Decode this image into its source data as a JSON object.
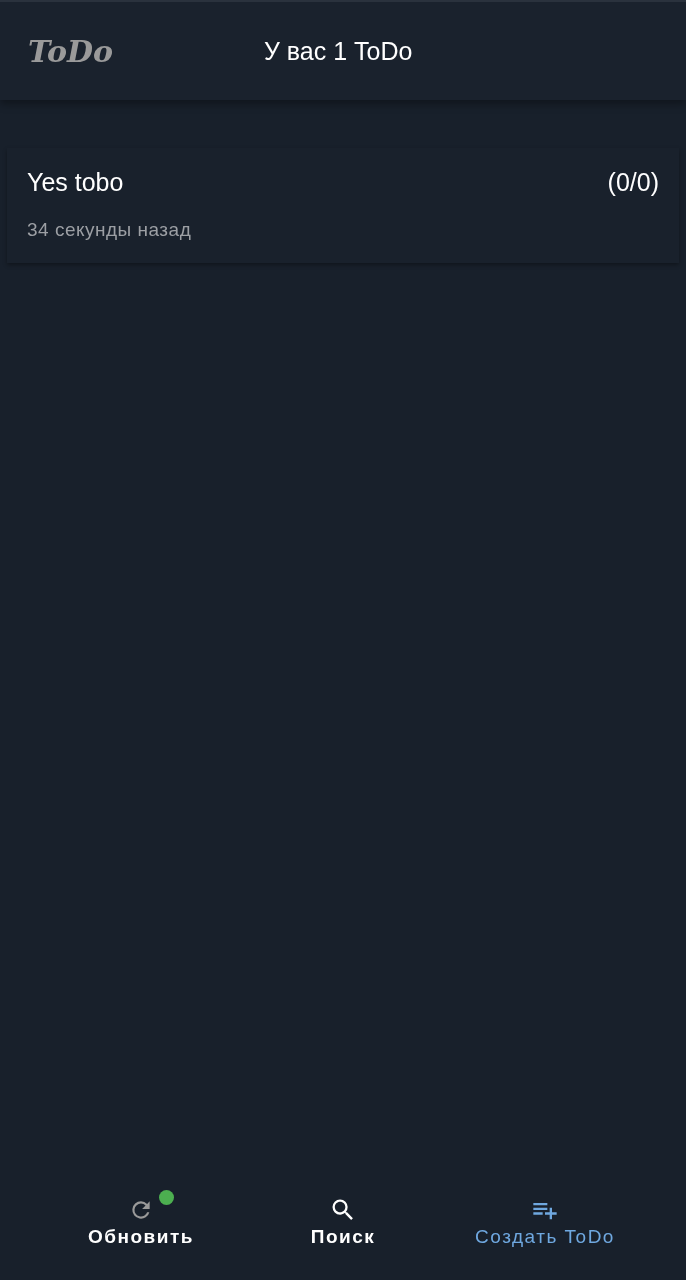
{
  "header": {
    "logo": "ToDo",
    "title": "У вас 1 ToDo"
  },
  "todos": [
    {
      "title": "Yes tobo",
      "count": "(0/0)",
      "time": "34 секунды назад"
    }
  ],
  "bottom_nav": [
    {
      "kind": "refresh",
      "label": "Обновить",
      "selected": false,
      "badge": true
    },
    {
      "kind": "search",
      "label": "Поиск",
      "selected": false,
      "badge": false
    },
    {
      "kind": "create",
      "label": "Создать ToDo",
      "selected": true,
      "badge": false
    }
  ]
}
